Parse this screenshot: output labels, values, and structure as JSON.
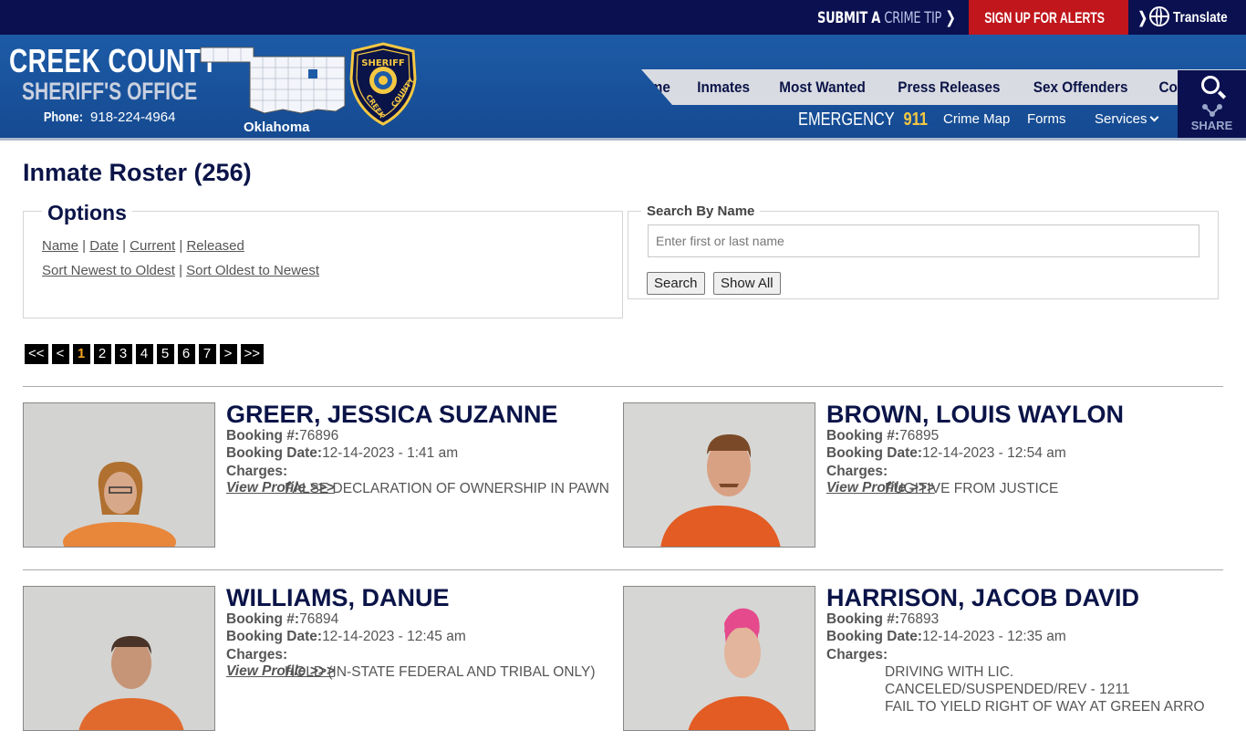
{
  "topbar": {
    "tip_main": "SUBMIT A ",
    "tip_hl": "CRIME TIP",
    "alerts": "SIGN UP FOR ALERTS",
    "translate": "Translate"
  },
  "header": {
    "brand_line1": "CREEK COUNTY",
    "brand_line2": "SHERIFF'S OFFICE",
    "phone_label": "Phone:",
    "phone_number": "918-224-4964",
    "state_label": "Oklahoma",
    "nav": [
      "Home",
      "Inmates",
      "Most Wanted",
      "Press Releases",
      "Sex Offenders",
      "Contact Us"
    ],
    "emergency_label": "EMERGENCY",
    "emergency_number": "911",
    "subnav": {
      "crime_map": "Crime Map",
      "forms": "Forms",
      "services": "Services"
    },
    "share_label": "SHARE"
  },
  "page": {
    "title": "Inmate Roster (256)",
    "options_legend": "Options",
    "sort_links": [
      "Name",
      "Date",
      "Current",
      "Released"
    ],
    "order_links": [
      "Sort Newest to Oldest",
      "Sort Oldest to Newest"
    ],
    "search_legend": "Search By Name",
    "search_placeholder": "Enter first or last name",
    "search_button": "Search",
    "show_all_button": "Show All"
  },
  "pager": {
    "items": [
      "<<",
      "<",
      "1",
      "2",
      "3",
      "4",
      "5",
      "6",
      "7",
      ">",
      ">>"
    ],
    "current": "1"
  },
  "labels": {
    "booking_no": "Booking #:",
    "booking_date": "Booking Date:",
    "charges": "Charges:",
    "view_profile": "View Profile >>>"
  },
  "inmates": [
    {
      "name": "GREER, JESSICA SUZANNE",
      "booking_no": "76896",
      "booking_date": "12-14-2023 - 1:41 am",
      "charges": [
        "FALSE DECLARATION OF OWNERSHIP IN PAWN"
      ]
    },
    {
      "name": "BROWN, LOUIS WAYLON",
      "booking_no": "76895",
      "booking_date": "12-14-2023 - 12:54 am",
      "charges": [
        "FUGITIVE FROM JUSTICE"
      ]
    },
    {
      "name": "WILLIAMS, DANUE",
      "booking_no": "76894",
      "booking_date": "12-14-2023 - 12:45 am",
      "charges": [
        "HOLD (IN-STATE FEDERAL AND TRIBAL ONLY)"
      ]
    },
    {
      "name": "HARRISON, JACOB DAVID",
      "booking_no": "76893",
      "booking_date": "12-14-2023 - 12:35 am",
      "charges": [
        "DRIVING WITH LIC. CANCELED/SUSPENDED/REV - 1211",
        "FAIL TO YIELD RIGHT OF WAY AT GREEN ARRO"
      ]
    }
  ],
  "colors": {
    "navy": "#0a1050",
    "header_blue": "#1d5ba7",
    "alert_red": "#c0161c",
    "emergency_yellow": "#f5c842",
    "title_navy": "#0b1448"
  }
}
